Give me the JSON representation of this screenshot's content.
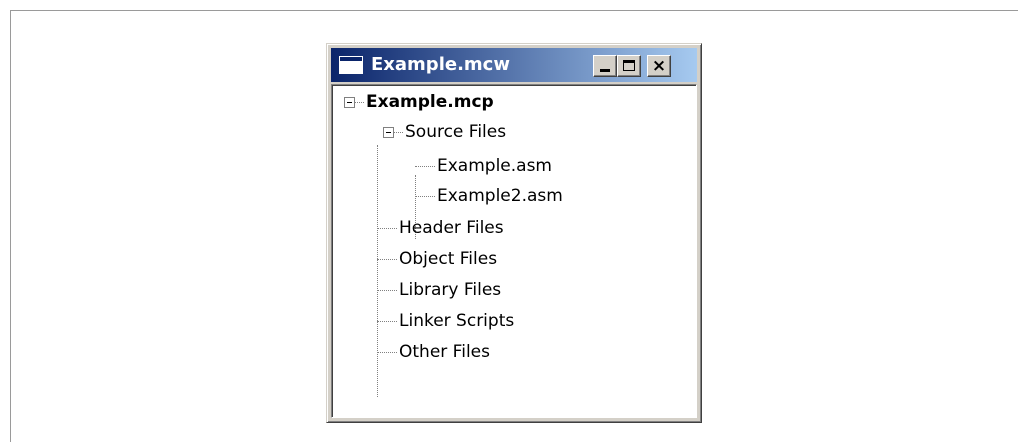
{
  "window": {
    "title": "Example.mcw",
    "buttons": {
      "minimize": "minimize",
      "maximize": "maximize",
      "close": "×"
    }
  },
  "tree": {
    "root": "Example.mcp",
    "source_folder": "Source Files",
    "source_files": [
      "Example.asm",
      "Example2.asm"
    ],
    "other_folders": [
      "Header Files",
      "Object Files",
      "Library Files",
      "Linker Scripts",
      "Other Files"
    ]
  }
}
